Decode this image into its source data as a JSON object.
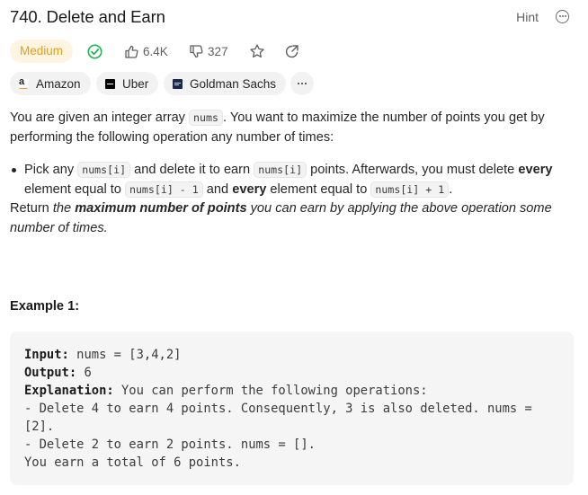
{
  "header": {
    "title": "740. Delete and Earn",
    "hint_label": "Hint",
    "more_icon": "more-horizontal-circle-icon"
  },
  "meta": {
    "difficulty": "Medium",
    "difficulty_color": "#e1a020",
    "solved_color": "#1cb350",
    "likes": "6.4K",
    "dislikes": "327"
  },
  "companies": [
    {
      "name": "Amazon",
      "icon": "amazon-logo"
    },
    {
      "name": "Uber",
      "icon": "uber-logo"
    },
    {
      "name": "Goldman Sachs",
      "icon": "goldman-sachs-logo"
    }
  ],
  "description": {
    "p1_a": "You are given an integer array ",
    "p1_code": "nums",
    "p1_b": ". You want to maximize the number of points you get by performing the following operation any number of times:",
    "b_a": "Pick any ",
    "b_code1": "nums[i]",
    "b_b": " and delete it to earn ",
    "b_code2": "nums[i]",
    "b_c": " points. Afterwards, you must delete ",
    "b_every1": "every",
    "b_d": " element equal to ",
    "b_code3": "nums[i] - 1",
    "b_e": " and ",
    "b_every2": "every",
    "b_f": " element equal to ",
    "b_code4": "nums[i] + 1",
    "b_g": ".",
    "p3_a": "Return ",
    "p3_b": "the ",
    "p3_bold": "maximum number of points",
    "p3_c": " you can earn by applying the above operation some number of times."
  },
  "example": {
    "title": "Example 1:",
    "input_label": "Input:",
    "input_value": " nums = [3,4,2]",
    "output_label": "Output:",
    "output_value": " 6",
    "explanation_label": "Explanation:",
    "explanation_value": " You can perform the following operations:",
    "line1": "- Delete 4 to earn 4 points. Consequently, 3 is also deleted. nums =",
    "line1b": "[2].",
    "line2": "- Delete 2 to earn 2 points. nums = [].",
    "line3": "You earn a total of 6 points."
  }
}
